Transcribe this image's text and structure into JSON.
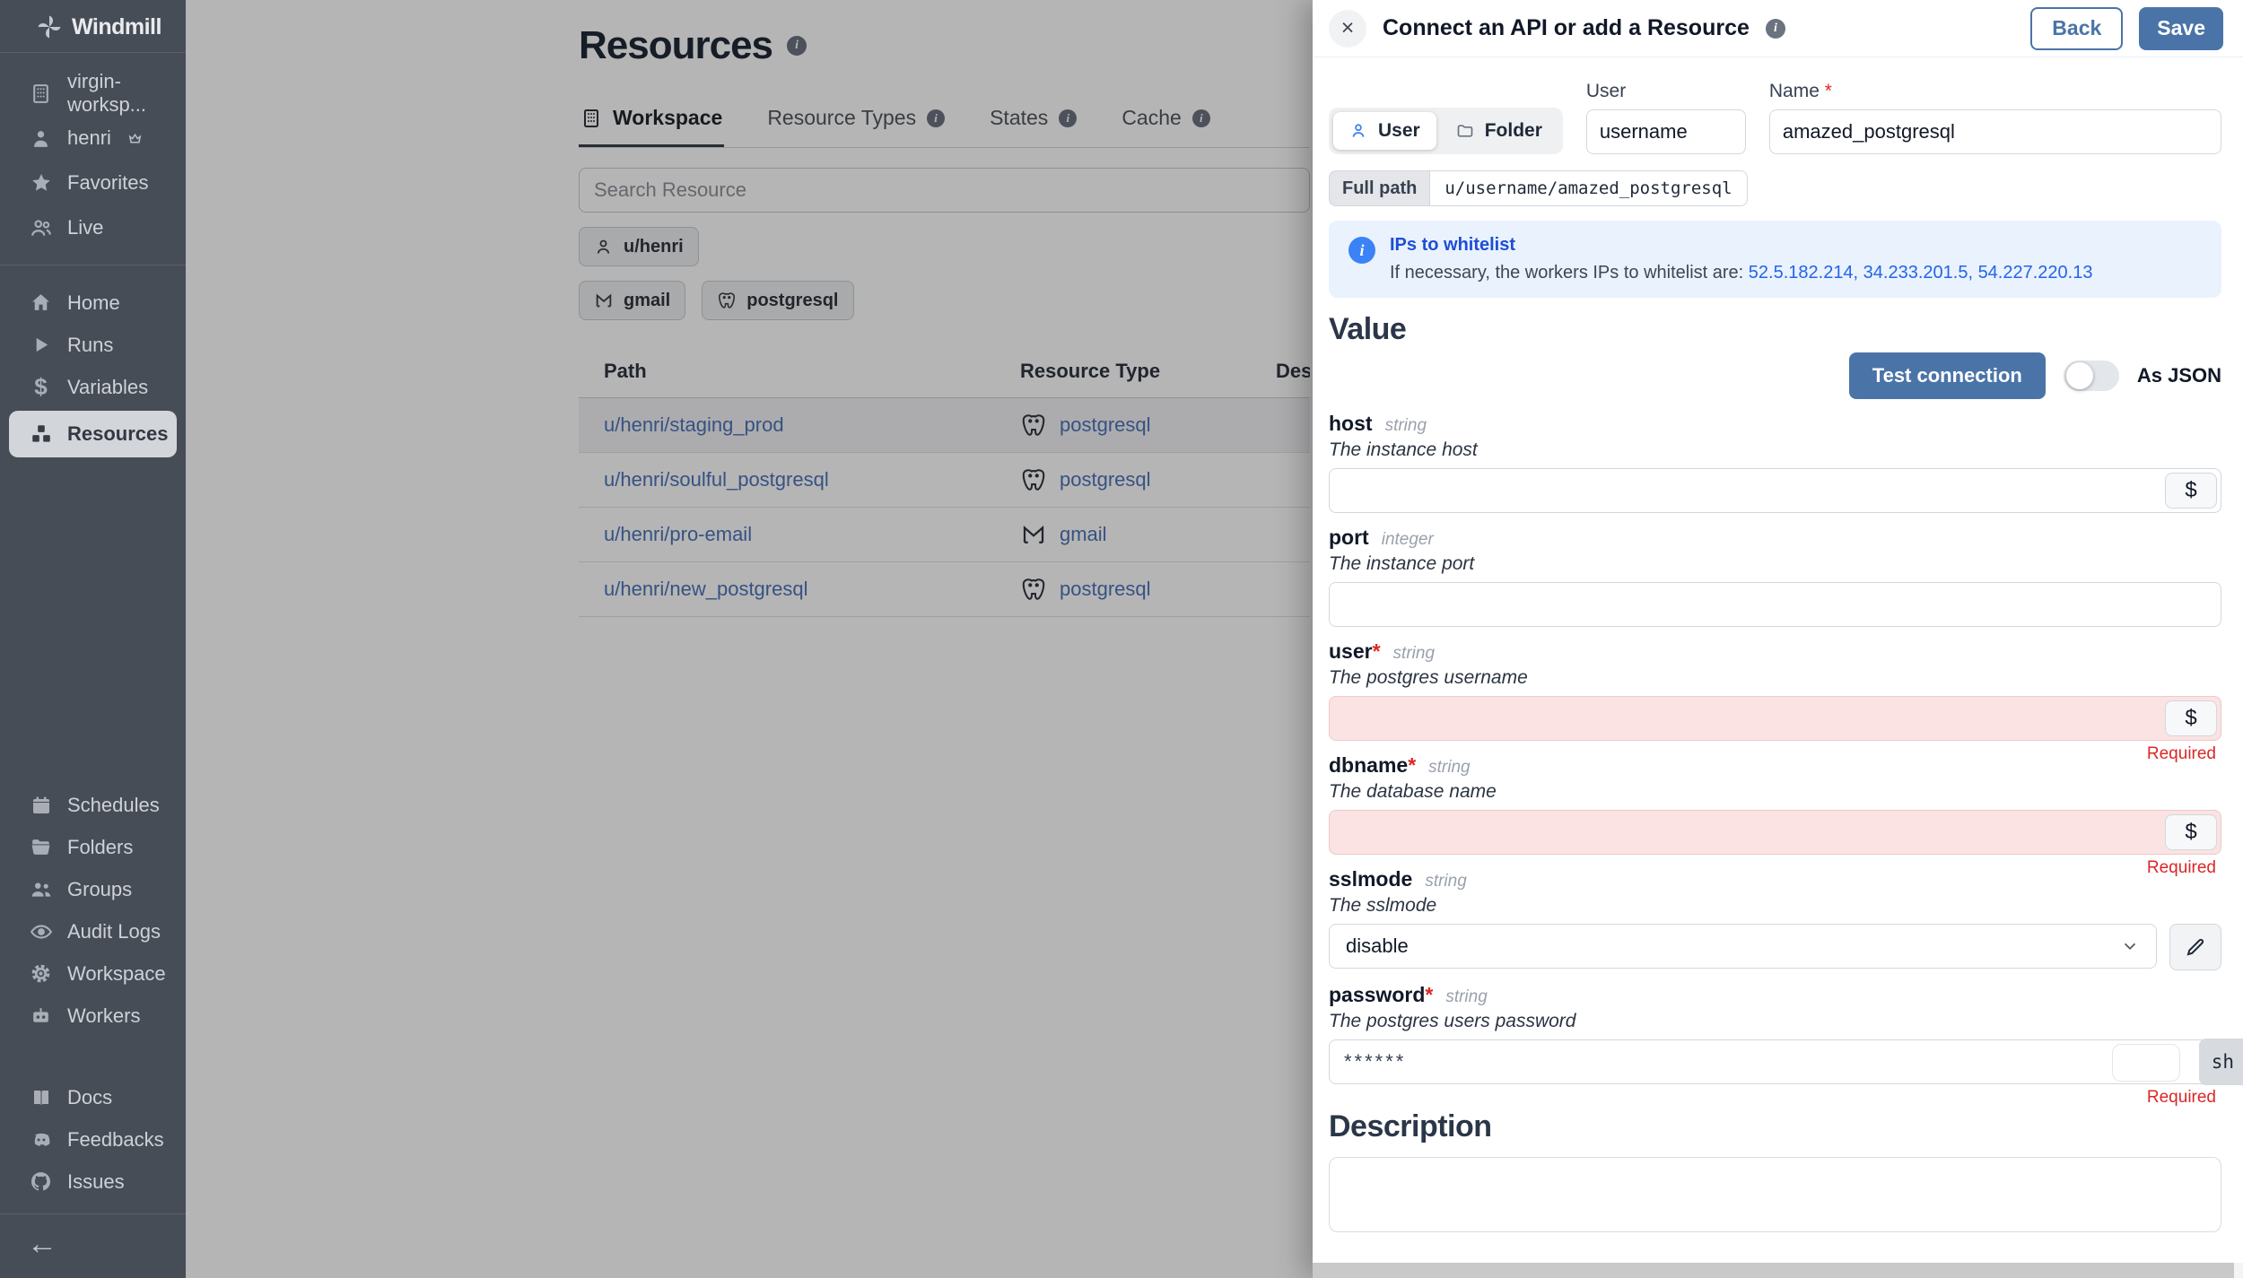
{
  "colors": {
    "sidebar_bg": "#474d57",
    "accent_blue": "#4a74a8",
    "link_blue": "#4c74b9",
    "info_bg": "#e9f2fd",
    "error_red": "#dc2626",
    "required_bg": "#fbe3e3"
  },
  "sidebar": {
    "logo": "Windmill",
    "workspace_items": [
      {
        "label": "virgin-worksp..."
      },
      {
        "label": "henri"
      },
      {
        "label": "Favorites"
      },
      {
        "label": "Live"
      }
    ],
    "nav": [
      {
        "label": "Home"
      },
      {
        "label": "Runs"
      },
      {
        "label": "Variables"
      },
      {
        "label": "Resources"
      }
    ],
    "admin": [
      {
        "label": "Schedules"
      },
      {
        "label": "Folders"
      },
      {
        "label": "Groups"
      },
      {
        "label": "Audit Logs"
      },
      {
        "label": "Workspace"
      },
      {
        "label": "Workers"
      }
    ],
    "links": [
      {
        "label": "Docs"
      },
      {
        "label": "Feedbacks"
      },
      {
        "label": "Issues"
      }
    ],
    "back_arrow": "←"
  },
  "main": {
    "title": "Resources",
    "tabs": [
      {
        "label": "Workspace"
      },
      {
        "label": "Resource Types"
      },
      {
        "label": "States"
      },
      {
        "label": "Cache"
      }
    ],
    "search_placeholder": "Search Resource",
    "owner_chip": "u/henri",
    "type_chips": [
      {
        "label": "gmail"
      },
      {
        "label": "postgresql"
      }
    ],
    "table": {
      "headers": [
        "Path",
        "Resource Type",
        "Desc"
      ],
      "rows": [
        {
          "path": "u/henri/staging_prod",
          "type": "postgresql"
        },
        {
          "path": "u/henri/soulful_postgresql",
          "type": "postgresql"
        },
        {
          "path": "u/henri/pro-email",
          "type": "gmail"
        },
        {
          "path": "u/henri/new_postgresql",
          "type": "postgresql"
        }
      ]
    }
  },
  "drawer": {
    "title": "Connect an API or add a Resource",
    "close_glyph": "×",
    "back_label": "Back",
    "save_label": "Save",
    "owner_toggle": {
      "user": "User",
      "folder": "Folder"
    },
    "user_field": {
      "label": "User",
      "value": "username"
    },
    "name_field": {
      "label": "Name",
      "required_mark": "*",
      "value": "amazed_postgresql"
    },
    "full_path": {
      "label": "Full path",
      "value": "u/username/amazed_postgresql"
    },
    "whitelist": {
      "title": "IPs to whitelist",
      "text": "If necessary, the workers IPs to whitelist are: ",
      "ips": "52.5.182.214, 34.233.201.5, 54.227.220.13"
    },
    "value_section": {
      "heading": "Value",
      "test_button": "Test connection",
      "as_json_label": "As JSON"
    },
    "dollar_glyph": "$",
    "fields": [
      {
        "name": "host",
        "mark": "",
        "type": "string",
        "desc": "The instance host",
        "value": ""
      },
      {
        "name": "port",
        "mark": "",
        "type": "integer",
        "desc": "The instance port",
        "value": ""
      },
      {
        "name": "user",
        "mark": "*",
        "type": "string",
        "desc": "The postgres username",
        "value": "",
        "error": "Required"
      },
      {
        "name": "dbname",
        "mark": "*",
        "type": "string",
        "desc": "The database name",
        "value": "",
        "error": "Required"
      },
      {
        "name": "sslmode",
        "mark": "",
        "type": "string",
        "desc": "The sslmode",
        "value": "disable"
      },
      {
        "name": "password",
        "mark": "*",
        "type": "string",
        "desc": "The postgres users password",
        "value": "******",
        "error": "Required",
        "show_label": "sh"
      }
    ],
    "description_section": {
      "heading": "Description"
    }
  }
}
